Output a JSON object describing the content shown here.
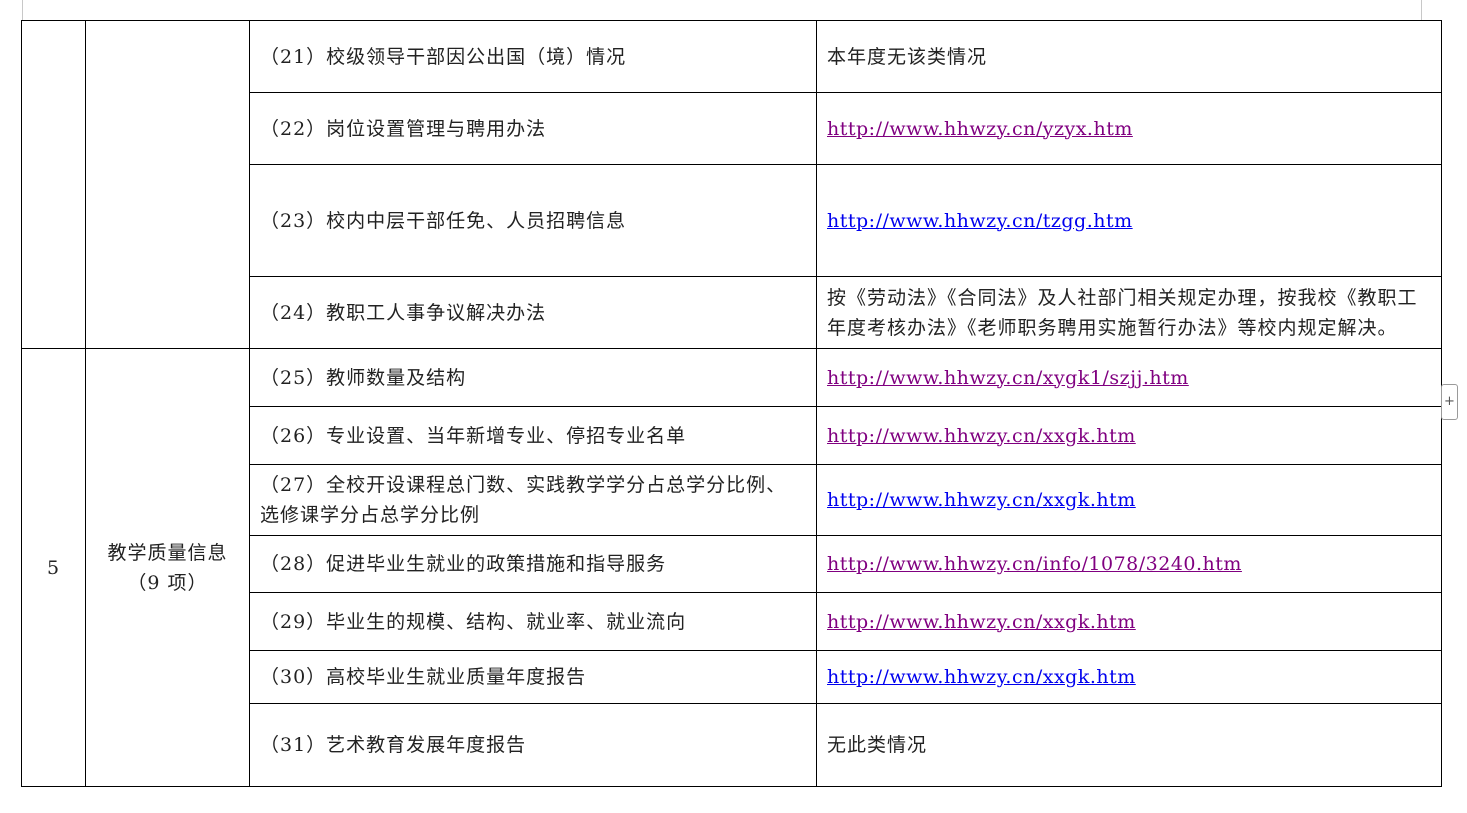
{
  "table": {
    "section_a": {
      "rows": [
        {
          "item": "（21）校级领导干部因公出国（境）情况",
          "value": "本年度无该类情况"
        },
        {
          "item": "（22）岗位设置管理与聘用办法",
          "value": "http://www.hhwzy.cn/yzyx.htm"
        },
        {
          "item": "（23）校内中层干部任免、人员招聘信息",
          "value": "http://www.hhwzy.cn/tzgg.htm"
        },
        {
          "item": "（24）教职工人事争议解决办法",
          "value": "按《劳动法》《合同法》及人社部门相关规定办理，按我校《教职工年度考核办法》《老师职务聘用实施暂行办法》等校内规定解决。"
        }
      ]
    },
    "section_b": {
      "number": "5",
      "category_line1": "教学质量信息",
      "category_line2": "（9 项）",
      "rows": [
        {
          "item": "（25）教师数量及结构",
          "value": "http://www.hhwzy.cn/xygk1/szjj.htm"
        },
        {
          "item": "（26）专业设置、当年新增专业、停招专业名单",
          "value": "http://www.hhwzy.cn/xxgk.htm"
        },
        {
          "item": "（27）全校开设课程总门数、实践教学学分占总学分比例、选修课学分占总学分比例",
          "value": "http://www.hhwzy.cn/xxgk.htm"
        },
        {
          "item": "（28）促进毕业生就业的政策措施和指导服务",
          "value": "http://www.hhwzy.cn/info/1078/3240.htm"
        },
        {
          "item": "（29）毕业生的规模、结构、就业率、就业流向",
          "value": "http://www.hhwzy.cn/xxgk.htm"
        },
        {
          "item": "（30）高校毕业生就业质量年度报告",
          "value": "http://www.hhwzy.cn/xxgk.htm"
        },
        {
          "item": "（31）艺术教育发展年度报告",
          "value": "无此类情况"
        }
      ]
    }
  },
  "add_row_button": {
    "label": "+"
  },
  "colors": {
    "link_visited": "#800080",
    "link_unvisited": "#0000ee",
    "border": "#000000",
    "text": "#222222"
  }
}
